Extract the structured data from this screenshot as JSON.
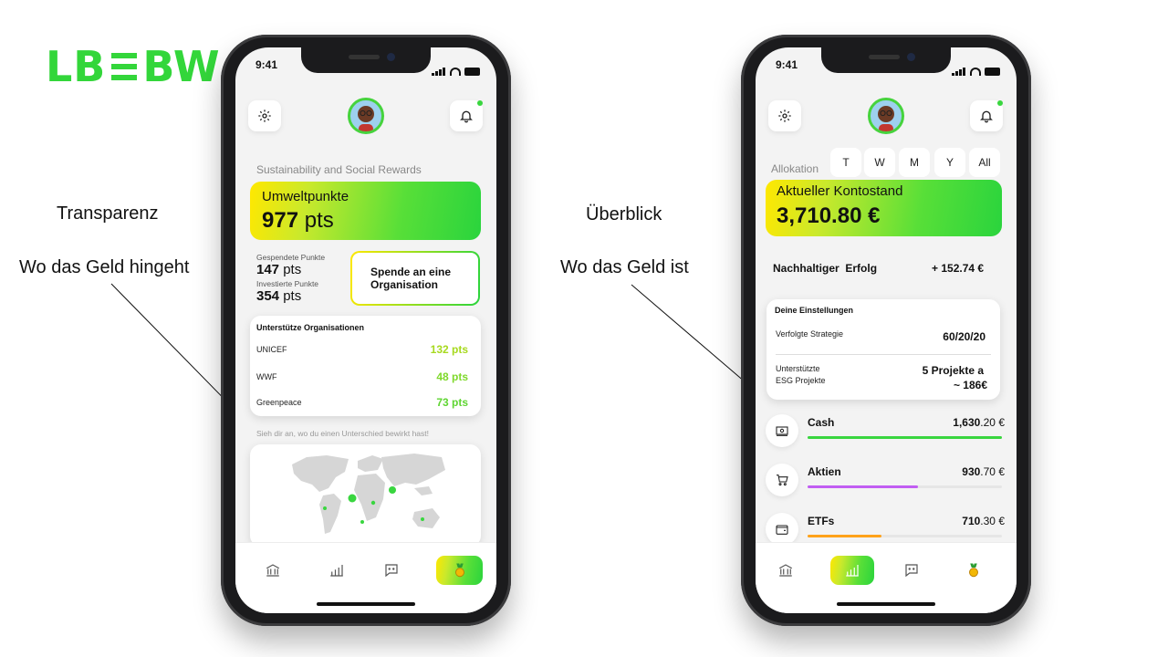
{
  "logo": {
    "text_left": "LB",
    "text_right": "BW",
    "color": "#33d63a"
  },
  "slide": {
    "left_heading": "Transparenz",
    "left_sub": "Wo das Geld hingeht",
    "right_heading": "Überblick",
    "right_sub": "Wo das Geld ist"
  },
  "status_bar": {
    "time": "9:41"
  },
  "left_screen": {
    "section_title": "Sustainability and Social Rewards",
    "points_card": {
      "title": "Umweltpunkte",
      "value": "977",
      "unit": "pts"
    },
    "donated": {
      "label": "Gespendete Punkte",
      "value": "147",
      "unit": "pts"
    },
    "invested": {
      "label": "Investierte Punkte",
      "value": "354",
      "unit": "pts"
    },
    "donate_button": "Spende an eine Organisation",
    "orgs": {
      "title": "Unterstütze Organisationen",
      "items": [
        {
          "name": "UNICEF",
          "points": "132 pts"
        },
        {
          "name": "WWF",
          "points": "48 pts"
        },
        {
          "name": "Greenpeace",
          "points": "73 pts"
        }
      ]
    },
    "map_caption": "Sieh dir an, wo du einen Unterschied bewirkt hast!"
  },
  "right_screen": {
    "allocation_label": "Allokation",
    "periods": [
      "T",
      "W",
      "M",
      "Y",
      "All"
    ],
    "selected_period": "M",
    "balance_card": {
      "title": "Aktueller Kontostand",
      "value": "3,710.80 €"
    },
    "sustainable_success": {
      "label": "Nachhaltiger  Erfolg",
      "value": "+ 152.74 €"
    },
    "settings": {
      "title": "Deine Einstellungen",
      "strategy_label": "Verfolgte Strategie",
      "strategy_value": "60/20/20",
      "esg_label_1": "Unterstützte",
      "esg_label_2": "ESG Projekte",
      "esg_value_1": "5 Projekte a",
      "esg_value_2": "~ 186€"
    },
    "assets": [
      {
        "name": "Cash",
        "amount_main": "1,630",
        "amount_dec": ".20 €",
        "share": 1.0,
        "color": "#39d63f",
        "icon": "banknote-icon"
      },
      {
        "name": "Aktien",
        "amount_main": "930",
        "amount_dec": ".70 €",
        "share": 0.57,
        "color": "#c15df2",
        "icon": "cart-icon"
      },
      {
        "name": "ETFs",
        "amount_main": "710",
        "amount_dec": ".30 €",
        "share": 0.38,
        "color": "#ffa21a",
        "icon": "wallet-icon"
      }
    ]
  }
}
